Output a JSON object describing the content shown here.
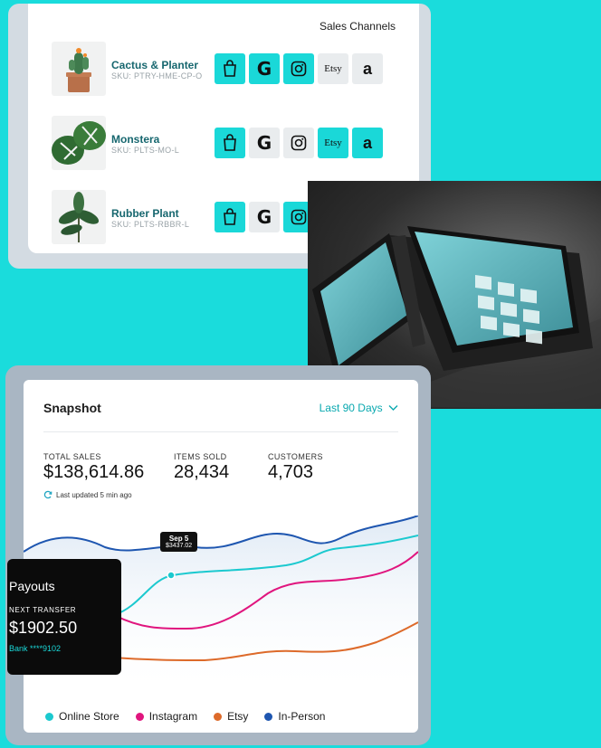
{
  "channels": {
    "title": "Sales Channels",
    "products": [
      {
        "name": "Cactus & Planter",
        "sku": "SKU: PTRY-HME-CP-O",
        "channels": [
          "on",
          "on",
          "on",
          "off",
          "off"
        ]
      },
      {
        "name": "Monstera",
        "sku": "SKU: PLTS-MO-L",
        "channels": [
          "on",
          "off",
          "off",
          "on",
          "on"
        ]
      },
      {
        "name": "Rubber Plant",
        "sku": "SKU: PLTS-RBBR-L",
        "channels": [
          "on",
          "off",
          "on"
        ]
      }
    ],
    "channel_icons": [
      "shopping-bag-icon",
      "google-icon",
      "instagram-icon",
      "etsy-icon",
      "amazon-icon"
    ],
    "google_text": "G",
    "etsy_text": "Etsy",
    "amazon_text": "a",
    "accent_color": "#1ad8d8"
  },
  "snapshot": {
    "title": "Snapshot",
    "range": "Last 90 Days",
    "stats": {
      "total_sales_label": "TOTAL SALES",
      "total_sales": "$138,614.86",
      "items_sold_label": "ITEMS SOLD",
      "items_sold": "28,434",
      "customers_label": "CUSTOMERS",
      "customers": "4,703"
    },
    "updated": "Last updated 5 min ago",
    "tooltip": {
      "date": "Sep 5",
      "value": "$3437.02"
    },
    "legend": [
      "Online Store",
      "Instagram",
      "Etsy",
      "In-Person"
    ],
    "colors": {
      "online": "#1bc9cf",
      "instagram": "#e0157e",
      "etsy": "#dd6a2a",
      "in_person": "#1e56b0"
    }
  },
  "payouts": {
    "title": "Payouts",
    "label": "NEXT TRANSFER",
    "amount": "$1902.50",
    "bank": "Bank ****9102"
  }
}
